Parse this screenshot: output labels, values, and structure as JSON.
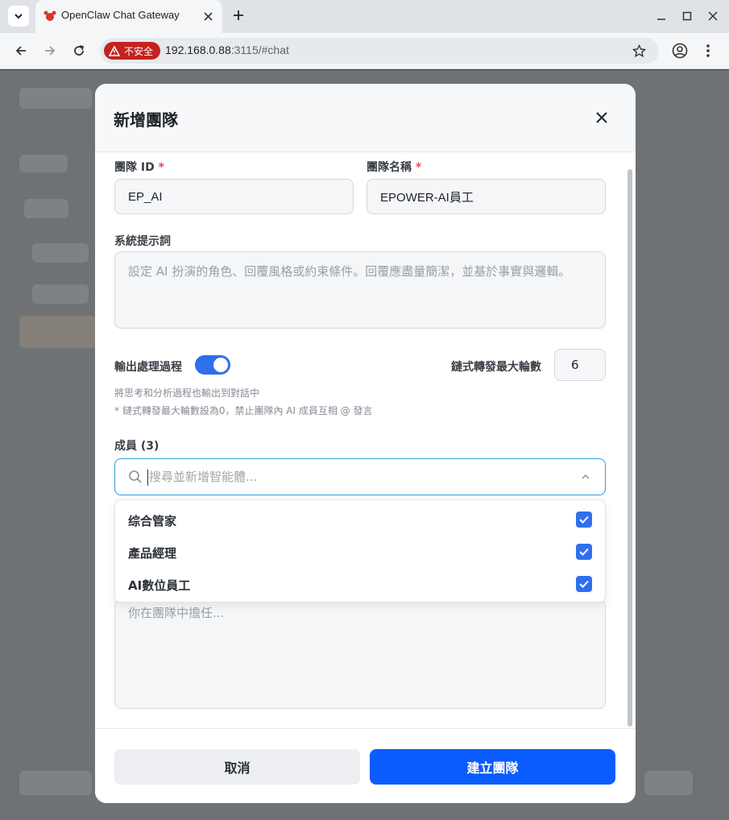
{
  "browser": {
    "tab_title": "OpenClaw Chat Gateway",
    "insecure_label": "不安全",
    "url_host": "192.168.0.88",
    "url_rest": ":3115/#chat"
  },
  "modal": {
    "title": "新增團隊",
    "team_id": {
      "label": "團隊 ID",
      "required_mark": "*",
      "value": "EP_AI"
    },
    "team_name": {
      "label": "團隊名稱",
      "required_mark": "*",
      "value": "EPOWER-AI員工"
    },
    "system_prompt": {
      "label": "系統提示詞",
      "placeholder": "設定 AI 扮演的角色、回覆風格或約束條件。回覆應盡量簡潔，並基於事實與邏輯。"
    },
    "output_process": {
      "label": "輸出處理過程",
      "enabled": true
    },
    "chain_max": {
      "label": "鏈式轉發最大輪數",
      "value": "6"
    },
    "hints": [
      "將思考和分析過程也輸出到對話中",
      "* 鏈式轉發最大輪數設為0，禁止團隊內 AI 成員互相 @ 發言"
    ],
    "members": {
      "label": "成員 (3)",
      "search_placeholder": "搜尋並新增智能體...",
      "options": [
        {
          "label": "综合管家",
          "checked": true
        },
        {
          "label": "產品經理",
          "checked": true
        },
        {
          "label": "AI數位員工",
          "checked": true
        }
      ],
      "role_placeholder": "你在團隊中擔任..."
    },
    "cancel_label": "取消",
    "submit_label": "建立團隊"
  },
  "colors": {
    "primary": "#0b5cff",
    "toggle_on": "#2f6fed",
    "insecure": "#c5221f",
    "required": "#e5484d"
  }
}
